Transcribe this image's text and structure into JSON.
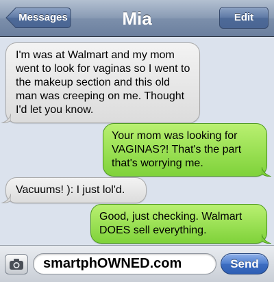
{
  "nav": {
    "title": "Mia",
    "back_label": "Messages",
    "edit_label": "Edit"
  },
  "messages": [
    {
      "direction": "incoming",
      "text": "I'm was at Walmart and my mom went to look for vaginas so I went to the makeup section and this old man was creeping on me. Thought I'd let you know."
    },
    {
      "direction": "outgoing",
      "text": "Your mom was looking for VAGINAS?! That's the part that's worrying me."
    },
    {
      "direction": "incoming",
      "text": "Vacuums! ): I just lol'd."
    },
    {
      "direction": "outgoing",
      "text": "Good, just checking. Walmart DOES sell everything."
    }
  ],
  "composer": {
    "camera_icon": "camera-icon",
    "input_value": "smartphOWNED.com",
    "send_label": "Send"
  },
  "colors": {
    "incoming_bubble": "#e6e6e6",
    "outgoing_bubble": "#9be255",
    "send_button": "#3c6cc0",
    "background": "#dbe2ed"
  }
}
